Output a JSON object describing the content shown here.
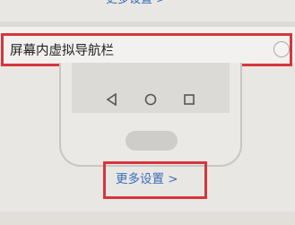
{
  "top_link": {
    "label": "更多设置 >"
  },
  "nav_toggle": {
    "label": "屏幕内虚拟导航栏",
    "checked": false
  },
  "phone_preview": {
    "nav_icons": [
      "back-triangle-icon",
      "home-circle-icon",
      "recent-square-icon"
    ]
  },
  "bottom_link": {
    "label": "更多设置 >"
  },
  "colors": {
    "link": "#3a6fb6",
    "highlight": "#d6363d",
    "background": "#e9e7e4"
  }
}
